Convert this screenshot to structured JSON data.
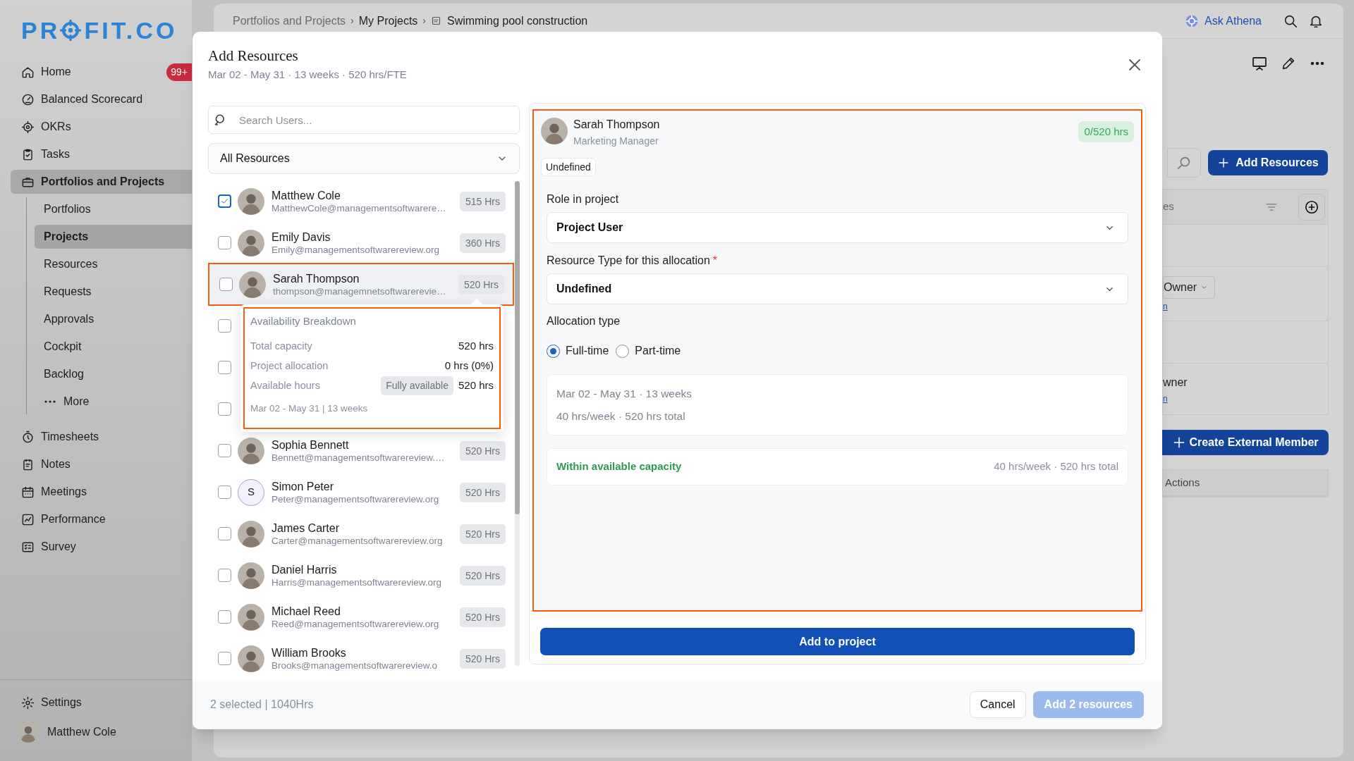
{
  "sidebar": {
    "logo": {
      "before": "PR",
      "after": "FIT.CO"
    },
    "nav": [
      {
        "label": "Home",
        "badge": "99+",
        "selected": false
      },
      {
        "label": "Balanced Scorecard",
        "selected": false
      },
      {
        "label": "OKRs",
        "selected": false
      },
      {
        "label": "Tasks",
        "selected": false
      },
      {
        "label": "Portfolios and Projects",
        "selected": true,
        "children": [
          {
            "label": "Portfolios",
            "selected": false
          },
          {
            "label": "Projects",
            "selected": true
          },
          {
            "label": "Resources",
            "selected": false
          },
          {
            "label": "Requests",
            "selected": false
          },
          {
            "label": "Approvals",
            "selected": false
          },
          {
            "label": "Cockpit",
            "selected": false
          },
          {
            "label": "Backlog",
            "selected": false
          },
          {
            "label": "More",
            "kind": "more",
            "selected": false
          }
        ]
      },
      {
        "label": "Timesheets",
        "selected": false
      },
      {
        "label": "Notes",
        "selected": false
      },
      {
        "label": "Meetings",
        "selected": false
      },
      {
        "label": "Performance",
        "selected": false
      },
      {
        "label": "Survey",
        "selected": false
      }
    ],
    "settings": "Settings",
    "user": "Matthew Cole"
  },
  "header": {
    "separator": "›",
    "breadcrumbs": [
      "Portfolios and Projects",
      "My Projects",
      "Swimming pool construction"
    ],
    "assistant": "Ask Athena"
  },
  "page": {
    "add_button": "Add Resources",
    "table": {
      "column_1": "es",
      "rows": [
        {
          "kind": "empty"
        },
        {
          "kind": "role",
          "value": "Owner",
          "link": "n"
        },
        {
          "kind": "empty"
        },
        {
          "kind": "text",
          "value": "wner",
          "link": "n"
        }
      ]
    },
    "create_button": "Create External Member",
    "table_2": {
      "column_1": "Actions"
    }
  },
  "modal": {
    "title": "Add Resources",
    "subtitle": "Mar 02 - May 31 · 13 weeks · 520 hrs/FTE",
    "search": {
      "placeholder": "Search Users..."
    },
    "filter": {
      "value": "All Resources"
    },
    "users": [
      {
        "kind": "photo",
        "name": "Matthew Cole",
        "email": "MatthewCole@managementsoftwarere…",
        "hours": "515 Hrs",
        "checked": true,
        "selected": false
      },
      {
        "kind": "photo",
        "name": "Emily Davis",
        "email": "Emily@managementsoftwarereview.org",
        "hours": "360 Hrs",
        "checked": false,
        "selected": false
      },
      {
        "kind": "photo",
        "name": "Sarah Thompson",
        "email": "thompson@managemnetsoftwarerevie…",
        "hours": "520 Hrs",
        "checked": false,
        "selected": true
      },
      {
        "kind": "covered",
        "checked": false,
        "selected": false
      },
      {
        "kind": "covered",
        "checked": false,
        "selected": false
      },
      {
        "kind": "covered",
        "checked": false,
        "selected": false
      },
      {
        "kind": "photo",
        "name": "Sophia Bennett",
        "email": "Bennett@managementsoftwarereview.…",
        "hours": "520 Hrs",
        "checked": false,
        "selected": false
      },
      {
        "kind": "initials",
        "initials": "S",
        "name": "Simon Peter",
        "email": "Peter@managementsoftwarereview.org",
        "hours": "520 Hrs",
        "checked": false,
        "selected": false
      },
      {
        "kind": "photo",
        "name": "James Carter",
        "email": "Carter@managementsoftwarereview.org",
        "hours": "520 Hrs",
        "checked": false,
        "selected": false
      },
      {
        "kind": "photo",
        "name": "Daniel Harris",
        "email": "Harris@managementsoftwarereview.org",
        "hours": "520 Hrs",
        "checked": false,
        "selected": false
      },
      {
        "kind": "photo",
        "name": "Michael Reed",
        "email": "Reed@managementsoftwarereview.org",
        "hours": "520 Hrs",
        "checked": false,
        "selected": false
      },
      {
        "kind": "photo",
        "name": "William Brooks",
        "email": "Brooks@managementsoftwarereview.o",
        "hours": "520 Hrs",
        "checked": false,
        "selected": false
      }
    ],
    "tooltip": {
      "title": "Availability Breakdown",
      "rows": [
        {
          "label": "Total capacity",
          "value": "520 hrs"
        },
        {
          "label": "Project allocation",
          "value": "0 hrs (0%)"
        },
        {
          "label": "Available hours",
          "tag": "Fully available",
          "value": "520 hrs"
        }
      ],
      "footer": "Mar 02 - May 31 | 13 weeks"
    },
    "detail": {
      "name": "Sarah Thompson",
      "role": "Marketing Manager",
      "hours": "0/520 hrs",
      "tag": "Undefined",
      "role_label": "Role in project",
      "role_value": "Project User",
      "type_label": "Resource Type for this allocation",
      "type_required_mark": "*",
      "type_value": "Undefined",
      "allocation_label": "Allocation type",
      "allocation_options": [
        {
          "label": "Full-time",
          "selected": true
        },
        {
          "label": "Part-time",
          "selected": false
        }
      ],
      "summary": [
        "Mar 02 - May 31 · 13 weeks",
        "40 hrs/week · 520 hrs total"
      ],
      "capacity": {
        "status": "Within available capacity",
        "detail": "40 hrs/week · 520 hrs total"
      }
    },
    "add_button": "Add to project",
    "footer": {
      "summary": "2 selected | 1040Hrs",
      "cancel": "Cancel",
      "confirm": "Add 2 resources",
      "confirm_disabled": true
    }
  }
}
